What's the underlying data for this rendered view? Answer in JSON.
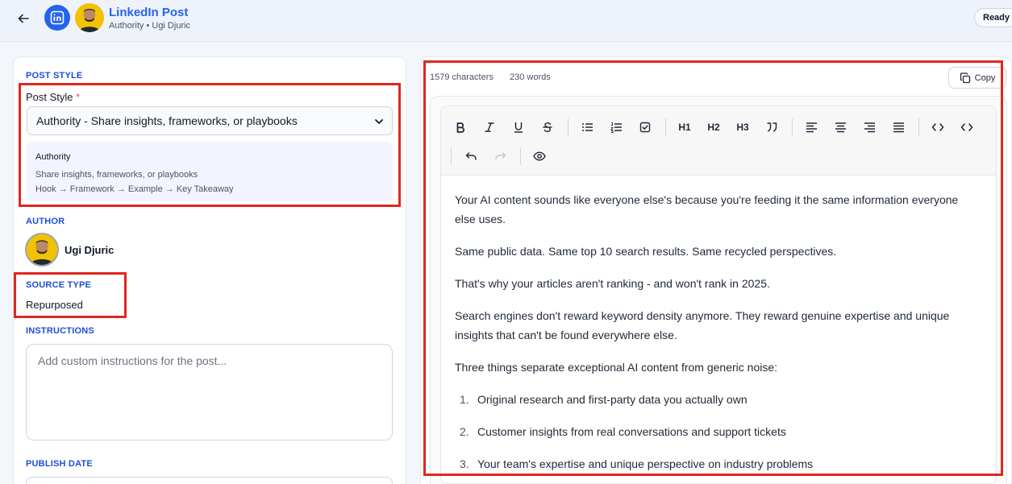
{
  "header": {
    "title": "LinkedIn Post",
    "subtitle": "Authority • Ugi Djuric",
    "status": "Ready"
  },
  "left": {
    "post_style_section": "POST STYLE",
    "post_style_label": "Post Style",
    "required_mark": "*",
    "post_style_value": "Authority - Share insights, frameworks, or playbooks",
    "style_card": {
      "name": "Authority",
      "description": "Share insights, frameworks, or playbooks",
      "flow": "Hook → Framework → Example → Key Takeaway"
    },
    "author_section": "AUTHOR",
    "author_name": "Ugi Djuric",
    "source_type_section": "SOURCE TYPE",
    "source_type_value": "Repurposed",
    "instructions_section": "INSTRUCTIONS",
    "instructions_placeholder": "Add custom instructions for the post...",
    "publish_date_section": "PUBLISH DATE"
  },
  "right": {
    "characters": "1579 characters",
    "words": "230 words",
    "copy_label": "Copy",
    "toolbar": {
      "h1": "H1",
      "h2": "H2",
      "h3": "H3"
    },
    "content": {
      "p1": "Your AI content sounds like everyone else's because you're feeding it the same information everyone else uses.",
      "p2": "Same public data. Same top 10 search results. Same recycled perspectives.",
      "p3": "That's why your articles aren't ranking - and won't rank in 2025.",
      "p4": "Search engines don't reward keyword density anymore. They reward genuine expertise and unique insights that can't be found everywhere else.",
      "p5": "Three things separate exceptional AI content from generic noise:",
      "list": [
        {
          "num": "1.",
          "text": "Original research and first-party data you actually own"
        },
        {
          "num": "2.",
          "text": "Customer insights from real conversations and support tickets"
        },
        {
          "num": "3.",
          "text": "Your team's expertise and unique perspective on industry problems"
        }
      ]
    }
  },
  "colors": {
    "accent": "#2563eb",
    "section_label": "#1d4ed8",
    "highlight": "#e0261f",
    "required": "#ef4444"
  },
  "icons": {
    "back": "arrow-left-icon",
    "linkedin": "linkedin-icon",
    "copy": "copy-icon",
    "bold": "bold-icon",
    "italic": "italic-icon",
    "underline": "underline-icon",
    "strike": "strikethrough-icon",
    "bullet_list": "bullet-list-icon",
    "ordered_list": "ordered-list-icon",
    "task_list": "checkbox-icon",
    "quote": "quote-icon",
    "align_left": "align-left-icon",
    "align_center": "align-center-icon",
    "align_right": "align-right-icon",
    "align_justify": "align-justify-icon",
    "code": "code-icon",
    "code_block": "code-block-icon",
    "undo": "undo-icon",
    "redo": "redo-icon",
    "preview": "eye-icon"
  }
}
